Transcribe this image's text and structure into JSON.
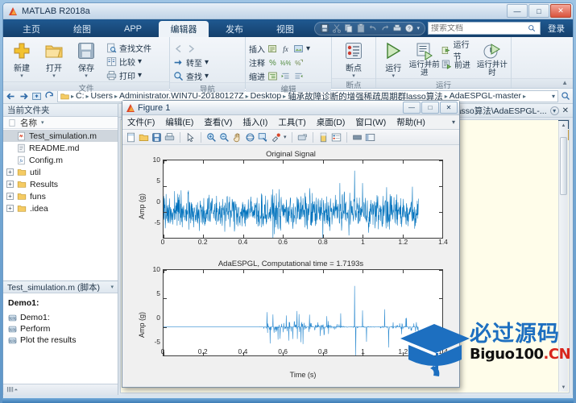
{
  "window": {
    "title": "MATLAB R2018a",
    "minimize": "—",
    "maximize": "□",
    "close": "✕"
  },
  "ribbon": {
    "tabs": [
      {
        "label": "主页",
        "active": false
      },
      {
        "label": "绘图",
        "active": false
      },
      {
        "label": "APP",
        "active": false
      },
      {
        "label": "编辑器",
        "active": true
      },
      {
        "label": "发布",
        "active": false
      },
      {
        "label": "视图",
        "active": false
      }
    ],
    "quick_access": [
      "save-icon",
      "cut-icon",
      "copy-icon",
      "paste-icon",
      "undo-icon",
      "redo-icon",
      "print-icon",
      "help-icon",
      "chevron-down-icon"
    ],
    "search": {
      "placeholder": "搜索文档",
      "icon": "search-icon"
    },
    "login_label": "登录",
    "groups": [
      {
        "label": "文件",
        "big_buttons": [
          {
            "label": "新建",
            "icon": "plus-icon",
            "caret": "▾"
          },
          {
            "label": "打开",
            "icon": "folder-icon",
            "caret": "▾"
          },
          {
            "label": "保存",
            "icon": "floppy-icon",
            "caret": "▾"
          }
        ],
        "small_buttons": [
          {
            "label": "查找文件",
            "icon": "find-file-icon",
            "caret": ""
          },
          {
            "label": "比较",
            "icon": "compare-icon",
            "caret": "▾"
          },
          {
            "label": "打印",
            "icon": "printer-icon",
            "caret": "▾"
          }
        ]
      },
      {
        "label": "导航",
        "big_buttons": [],
        "small_buttons": [
          {
            "label": "",
            "icon": "nav-back-icon",
            "caret": ""
          },
          {
            "label": "转至",
            "icon": "goto-icon",
            "caret": "▾"
          },
          {
            "label": "查找",
            "icon": "search-glass-icon",
            "caret": "▾"
          }
        ]
      },
      {
        "label": "编辑",
        "big_buttons": [],
        "small_buttons": [
          {
            "label": "插入",
            "icon": "insert-icon",
            "caret": "▾"
          },
          {
            "label": "注释",
            "icon": "comment-icon",
            "caret": ""
          },
          {
            "label": "缩进",
            "icon": "indent-icon",
            "caret": ""
          }
        ]
      },
      {
        "label": "断点",
        "big_buttons": [
          {
            "label": "断点",
            "icon": "breakpoint-icon",
            "caret": "▾"
          }
        ],
        "small_buttons": []
      },
      {
        "label": "运行",
        "big_buttons": [
          {
            "label": "运行",
            "icon": "run-icon",
            "caret": "▾"
          },
          {
            "label": "运行并前进",
            "icon": "run-advance-icon",
            "caret": ""
          },
          {
            "label": "运行并计时",
            "icon": "run-time-icon",
            "caret": ""
          }
        ],
        "small_buttons": [
          {
            "label": "运行节",
            "icon": "run-section-icon",
            "caret": ""
          },
          {
            "label": "前进",
            "icon": "advance-icon",
            "caret": ""
          }
        ]
      }
    ]
  },
  "address_bar": {
    "nav_icons": [
      "back-arrow-icon",
      "forward-arrow-icon",
      "up-folder-icon",
      "refresh-icon"
    ],
    "folder_icon": "folder-icon",
    "crumbs": [
      "C:",
      "Users",
      "Administrator.WIN7U-20180127Z",
      "Desktop",
      "轴承故障诊断的增强稀疏周期群lasso算法",
      "AdaESPGL-master"
    ],
    "separator": "▸",
    "dropdown": "▾",
    "search_icon": "search-icon"
  },
  "file_browser": {
    "panel_title": "当前文件夹",
    "column_header": {
      "icon": "file-icon",
      "label": "名称",
      "sort": "▾"
    },
    "items": [
      {
        "label": "Test_simulation.m",
        "icon": "m-file-icon",
        "expandable": false,
        "selected": true
      },
      {
        "label": "README.md",
        "icon": "doc-file-icon",
        "expandable": false,
        "selected": false
      },
      {
        "label": "Config.m",
        "icon": "fx-file-icon",
        "expandable": false,
        "selected": false
      },
      {
        "label": "util",
        "icon": "folder-icon",
        "expandable": true,
        "selected": false
      },
      {
        "label": "Results",
        "icon": "folder-icon",
        "expandable": true,
        "selected": false
      },
      {
        "label": "funs",
        "icon": "folder-icon",
        "expandable": true,
        "selected": false
      },
      {
        "label": ".idea",
        "icon": "folder-icon",
        "expandable": true,
        "selected": false
      }
    ]
  },
  "details_panel": {
    "header": "Test_simulation.m  (脚本)",
    "header_caret": "▾",
    "title": "Demo1:",
    "rows": [
      {
        "label": "Demo1:",
        "icon": "section-icon"
      },
      {
        "label": "Perform",
        "icon": "section-icon"
      },
      {
        "label": "Plot the results",
        "icon": "section-icon"
      }
    ]
  },
  "editor": {
    "tab_label": "asso算法\\AdaESPGL-...",
    "tab_dropdown": "▾",
    "tab_close": "✕"
  },
  "figure_window": {
    "title": "Figure 1",
    "icon": "matlab-logo-icon",
    "buttons": {
      "minimize": "—",
      "maximize": "□",
      "close": "✕"
    },
    "menus": [
      "文件(F)",
      "编辑(E)",
      "查看(V)",
      "插入(I)",
      "工具(T)",
      "桌面(D)",
      "窗口(W)",
      "帮助(H)"
    ],
    "menu_dropdown": "▾",
    "toolbar": [
      "new-figure-icon",
      "open-figure-icon",
      "save-figure-icon",
      "print-figure-icon",
      "pointer-icon",
      "zoom-in-icon",
      "zoom-out-icon",
      "pan-icon",
      "rotate3d-icon",
      "data-cursor-icon",
      "brush-icon",
      "brush-caret-icon",
      "link-plot-icon",
      "colorbar-icon",
      "legend-icon",
      "hide-plot-tools-icon",
      "show-plot-tools-icon"
    ]
  },
  "watermark": {
    "cn": "必过源码",
    "en_black": "Biguo100",
    "en_dot": ".",
    "en_red": "CN",
    "icon": "graduation-cap-icon"
  },
  "chart_data": [
    {
      "type": "line",
      "title": "Original Signal",
      "xlabel": "",
      "ylabel": "Amp (g)",
      "xlim": [
        0,
        1.4
      ],
      "ylim": [
        -5,
        10
      ],
      "xticks": [
        0,
        0.2,
        0.4,
        0.6,
        0.8,
        1,
        1.2,
        1.4
      ],
      "xticklabels": [
        "0",
        "0.2",
        "0.4",
        "0.6",
        "0.8",
        "1",
        "1.2",
        "1.4"
      ],
      "yticks": [
        -5,
        0,
        5,
        10
      ],
      "yticklabels": [
        "-5",
        "0",
        "5",
        "10"
      ],
      "grid": false,
      "legend": null,
      "color": "#0072bd",
      "description": "Dense broadband noisy vibration signal spanning t=0 to 1.28 s, amplitude band roughly -4 to +4 g with sparse impulses reaching +8 g near t=0.96 s and -5.5 g near t=0.55 s.",
      "x_data_end": 1.28,
      "noise_band": [
        -4,
        4
      ],
      "impulse_peaks": [
        {
          "t": 0.55,
          "amp": -5.4
        },
        {
          "t": 0.735,
          "amp": 4.6
        },
        {
          "t": 0.8,
          "amp": -5.2
        },
        {
          "t": 0.885,
          "amp": 5.6
        },
        {
          "t": 0.96,
          "amp": 8.0
        },
        {
          "t": 1.0,
          "amp": 5.6
        },
        {
          "t": 1.12,
          "amp": 4.8
        },
        {
          "t": 1.25,
          "amp": 4.9
        }
      ]
    },
    {
      "type": "line",
      "title": "AdaESPGL, Computational time = 1.7193s",
      "xlabel": "Time (s)",
      "ylabel": "Amp (g)",
      "xlim": [
        0,
        1.4
      ],
      "ylim": [
        -5,
        10
      ],
      "xticks": [
        0,
        0.2,
        0.4,
        0.6,
        0.8,
        1,
        1.2,
        1.4
      ],
      "xticklabels": [
        "0",
        "0.2",
        "0.4",
        "0.6",
        "0.8",
        "1",
        "1.2",
        "1.4"
      ],
      "yticks": [
        -5,
        0,
        5,
        10
      ],
      "yticklabels": [
        "-5",
        "0",
        "5",
        "10"
      ],
      "grid": false,
      "legend": null,
      "color": "#2e8bd0",
      "description": "Sparse deconvolved periodic impulse train; flat zero from t=0 to about 0.48 s then periodic impulse groups to t=1.28 s.",
      "x_data_end": 1.28,
      "sparse_start": 0.48,
      "impulse_peaks": [
        {
          "t": 0.52,
          "amp": 2.6
        },
        {
          "t": 0.535,
          "amp": -2.9
        },
        {
          "t": 0.55,
          "amp": 2.2
        },
        {
          "t": 0.63,
          "amp": -2.4
        },
        {
          "t": 0.67,
          "amp": 2.8
        },
        {
          "t": 0.7,
          "amp": -3.0
        },
        {
          "t": 0.82,
          "amp": 1.9
        },
        {
          "t": 0.89,
          "amp": 2.4
        },
        {
          "t": 0.96,
          "amp": 7.2
        },
        {
          "t": 0.965,
          "amp": -5.0
        },
        {
          "t": 1.0,
          "amp": 2.9
        },
        {
          "t": 1.02,
          "amp": -2.6
        },
        {
          "t": 1.11,
          "amp": 3.1
        },
        {
          "t": 1.13,
          "amp": -3.6
        },
        {
          "t": 1.22,
          "amp": 1.6
        }
      ]
    }
  ]
}
